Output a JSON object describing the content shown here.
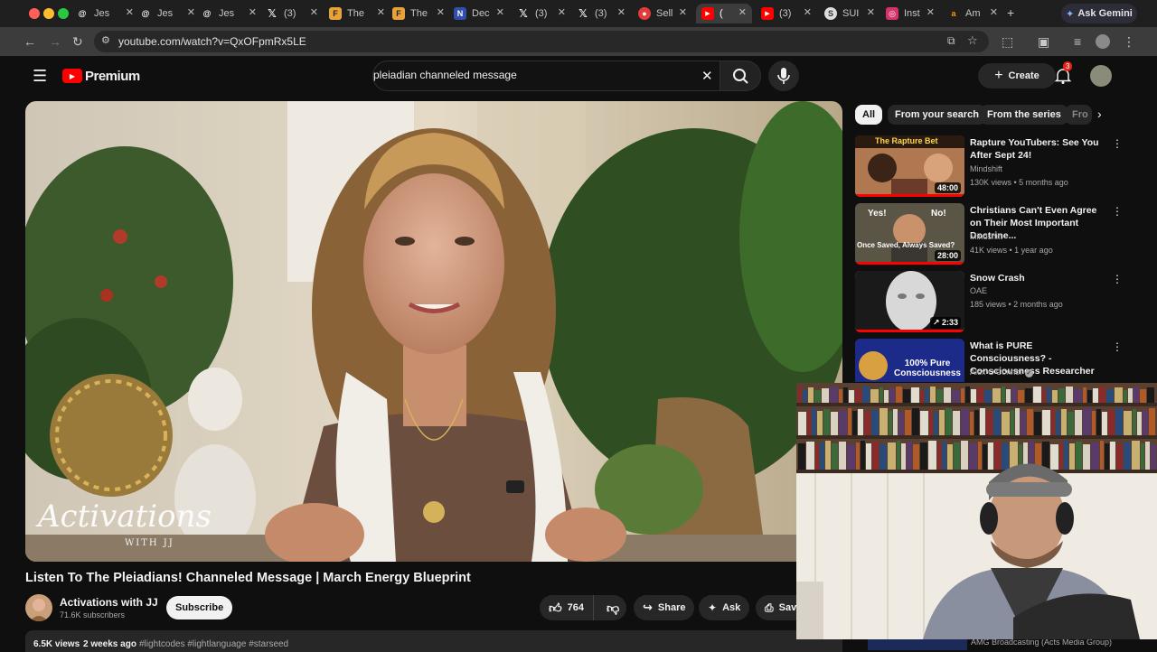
{
  "browser": {
    "tabs": [
      {
        "title": "Jes",
        "icon": "threads-icon"
      },
      {
        "title": "Jes",
        "icon": "threads-icon"
      },
      {
        "title": "Jes",
        "icon": "threads-icon"
      },
      {
        "title": "(3)",
        "icon": "x-icon"
      },
      {
        "title": "The",
        "icon": "f-icon"
      },
      {
        "title": "The",
        "icon": "f-icon"
      },
      {
        "title": "Dec",
        "icon": "n-icon"
      },
      {
        "title": "(3)",
        "icon": "x-icon"
      },
      {
        "title": "(3)",
        "icon": "x-icon"
      },
      {
        "title": "Sell",
        "icon": "red-logo-icon"
      },
      {
        "title": "(",
        "icon": "youtube-icon"
      },
      {
        "title": "(3)",
        "icon": "youtube-icon"
      },
      {
        "title": "SUI",
        "icon": "sui-icon"
      },
      {
        "title": "Inst",
        "icon": "instagram-icon"
      },
      {
        "title": "Am",
        "icon": "amazon-icon"
      }
    ],
    "ask_gemini": "Ask Gemini",
    "url": "youtube.com/watch?v=QxOFpmRx5LE"
  },
  "youtube": {
    "logo_text": "Premium",
    "search_value": "pleiadian channeled message",
    "create_label": "Create",
    "notification_count": "3",
    "chips": [
      "All",
      "From your search",
      "From the series",
      "Fro"
    ],
    "video": {
      "watermark": "Activations",
      "watermark_sub": "WITH JJ",
      "title": "Listen To The Pleiadians! Channeled Message | March Energy Blueprint",
      "channel": "Activations with JJ",
      "subscribers": "71.6K subscribers",
      "subscribe_label": "Subscribe",
      "likes": "764",
      "share_label": "Share",
      "ask_label": "Ask",
      "save_label": "Save",
      "views": "6.5K views",
      "age": "2 weeks ago",
      "hashtags": "#lightcodes #lightlanguage #starseed"
    },
    "recommendations": [
      {
        "title": "Rapture YouTubers: See You After Sept 24!",
        "channel": "Mindshift",
        "meta": "130K views • 5 months ago",
        "duration": "48:00",
        "thumb_text": "The Rapture Bet",
        "thumb_color": "#8a5a3a"
      },
      {
        "title": "Christians Can't Even Agree on Their Most Important Doctrine...",
        "channel": "Mindshift",
        "meta": "41K views • 1 year ago",
        "duration": "28:00",
        "thumb_text_top_left": "Yes!",
        "thumb_text_top_right": "No!",
        "thumb_text_bottom": "Once Saved, Always Saved?",
        "thumb_color": "#4a4a3a"
      },
      {
        "title": "Snow Crash",
        "channel": "OAE",
        "meta": "185 views • 2 months ago",
        "duration": "2:33",
        "thumb_color": "#d0d0d0"
      },
      {
        "title": "What is PURE Consciousness? - Consciousness Researcher",
        "channel": "Alex O'Connor",
        "meta": "",
        "duration": "",
        "thumb_text": "100% Pure Consciousness",
        "thumb_color": "#2a3aa8"
      }
    ],
    "bottom_rec_channel": "AMG Broadcasting (Acts Media Group)"
  }
}
